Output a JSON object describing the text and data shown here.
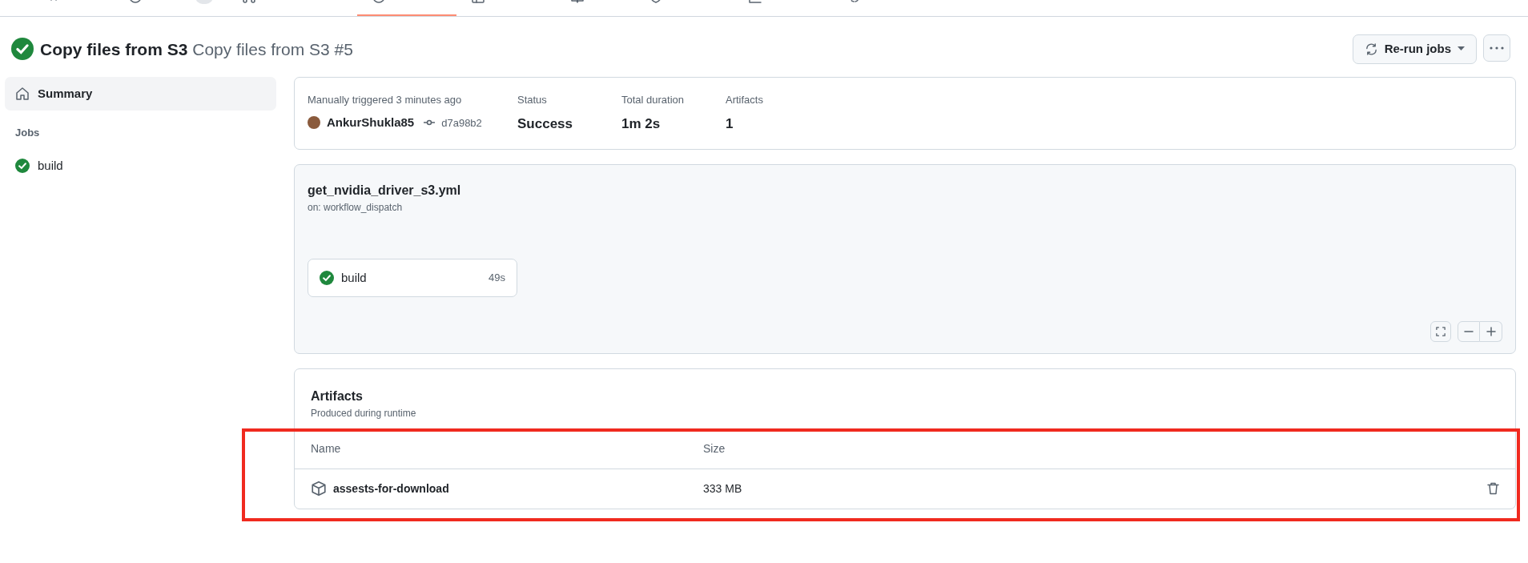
{
  "repo_tabs": [
    {
      "kind": "plain",
      "selected": false
    },
    {
      "kind": "counter",
      "selected": false
    },
    {
      "kind": "plain",
      "selected": false
    },
    {
      "kind": "plain",
      "selected": true
    },
    {
      "kind": "plain",
      "selected": false
    },
    {
      "kind": "plain",
      "selected": false
    },
    {
      "kind": "plain",
      "selected": false
    },
    {
      "kind": "plain",
      "selected": false
    },
    {
      "kind": "plain",
      "selected": false
    }
  ],
  "run": {
    "passed": true,
    "workflow": "Copy files from S3",
    "title": "Copy files from S3 #5"
  },
  "actions": {
    "rerun": "Re-run jobs"
  },
  "sidebar": {
    "items": [
      {
        "label": "Summary",
        "selected": true
      }
    ],
    "jobs_heading": "Jobs",
    "jobs": [
      {
        "label": "build",
        "passed": true
      }
    ]
  },
  "summary": {
    "trigger": "Manually triggered 3 minutes ago",
    "user": "AnkurShukla85",
    "commit": "d7a98b2",
    "stats": [
      {
        "label": "Status",
        "value": "Success"
      },
      {
        "label": "Total duration",
        "value": "1m 2s"
      },
      {
        "label": "Artifacts",
        "value": "1"
      }
    ]
  },
  "workflow": {
    "file": "get_nvidia_driver_s3.yml",
    "trigger": "on: workflow_dispatch",
    "jobs": [
      {
        "label": "build",
        "passed": true,
        "duration": "49s"
      }
    ]
  },
  "artifacts": {
    "title": "Artifacts",
    "subtitle": "Produced during runtime",
    "columns": [
      "Name",
      "Size"
    ],
    "rows": [
      {
        "name": "assests-for-download",
        "size": "333 MB"
      }
    ]
  },
  "annotation": {
    "kind": "frame"
  }
}
